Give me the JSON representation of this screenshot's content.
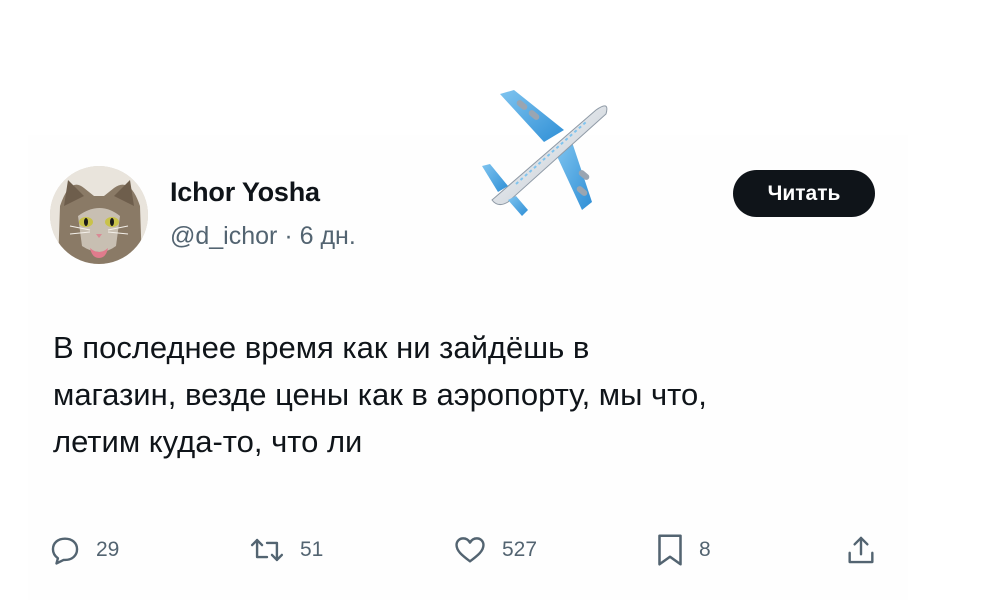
{
  "author": {
    "display_name": "Ichor Yosha",
    "handle": "@d_ichor",
    "separator": "·",
    "time_ago": "6 дн."
  },
  "header_button": {
    "label": "Читать"
  },
  "decoration": {
    "emoji": "airplane-icon"
  },
  "tweet": {
    "lines": [
      "В последнее время как ни зайдёшь в",
      "магазин, везде цены как в аэропорту, мы что,",
      "летим куда-то, что ли"
    ]
  },
  "actions": {
    "replies": "29",
    "retweets": "51",
    "likes": "527",
    "bookmarks": "8"
  },
  "colors": {
    "text": "#0f1419",
    "secondary": "#536471",
    "button_bg": "#0f1419"
  }
}
